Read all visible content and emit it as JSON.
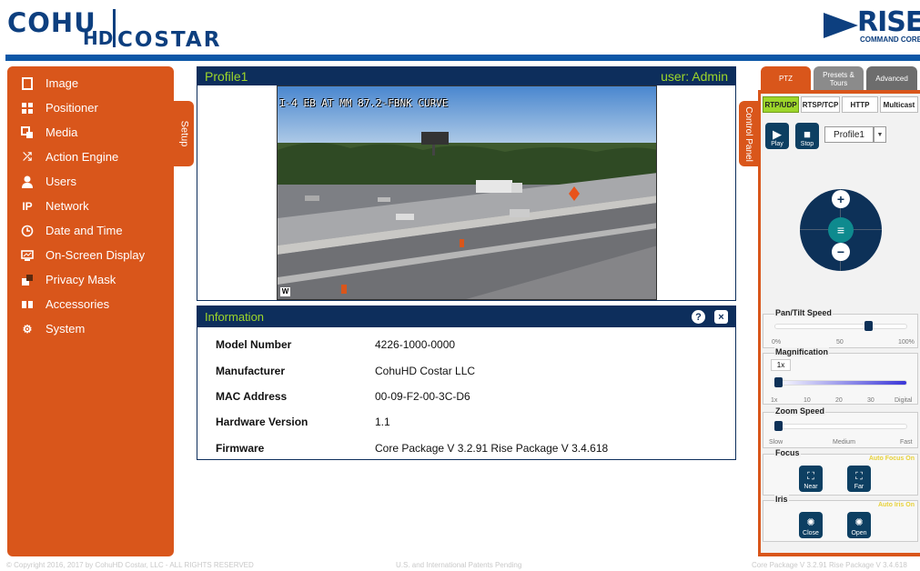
{
  "brand": {
    "left_top": "COHU",
    "left_hd": "HD",
    "left_bottom": "COSTAR",
    "right_word": "RISE",
    "right_sub": "COMMAND CORE"
  },
  "sidebar": {
    "items": [
      {
        "label": "Image",
        "icon": "image-icon"
      },
      {
        "label": "Positioner",
        "icon": "positioner-icon"
      },
      {
        "label": "Media",
        "icon": "media-icon"
      },
      {
        "label": "Action Engine",
        "icon": "shuffle-icon"
      },
      {
        "label": "Users",
        "icon": "user-icon"
      },
      {
        "label": "Network",
        "icon": "ip-icon"
      },
      {
        "label": "Date and Time",
        "icon": "clock-icon"
      },
      {
        "label": "On-Screen Display",
        "icon": "monitor-icon"
      },
      {
        "label": "Privacy Mask",
        "icon": "mask-icon"
      },
      {
        "label": "Accessories",
        "icon": "accessories-icon"
      },
      {
        "label": "System",
        "icon": "gear-icon"
      }
    ],
    "setup_tab": "Setup"
  },
  "video": {
    "profile": "Profile1",
    "user": "user: Admin",
    "caption": "I-4 EB AT MM 87.2-FBNK CURVE",
    "watermark": "W"
  },
  "info": {
    "title": "Information",
    "help": "?",
    "close": "×",
    "rows": [
      {
        "key": "Model Number",
        "value": "4226-1000-0000"
      },
      {
        "key": "Manufacturer",
        "value": "CohuHD Costar LLC"
      },
      {
        "key": "MAC Address",
        "value": "00-09-F2-00-3C-D6"
      },
      {
        "key": "Hardware Version",
        "value": "1.1"
      },
      {
        "key": "Firmware",
        "value": "Core Package V 3.2.91 Rise Package V 3.4.618"
      }
    ]
  },
  "control_panel": {
    "side_tab": "Control Panel",
    "tabs": [
      "PTZ",
      "Presets & Tours",
      "Advanced"
    ],
    "protocols": [
      "RTP/UDP",
      "RTSP/TCP",
      "HTTP",
      "Multicast"
    ],
    "play": "Play",
    "stop": "Stop",
    "profile": "Profile1",
    "pan_tilt": {
      "title": "Pan/Tilt Speed",
      "scale": [
        "0%",
        "50",
        "100%"
      ],
      "value_percent": 72
    },
    "magnification": {
      "title": "Magnification",
      "tooltip": "1x",
      "scale": [
        "1x",
        "10",
        "20",
        "30",
        "Digital"
      ],
      "value_fraction": 0.0
    },
    "zoom_speed": {
      "title": "Zoom Speed",
      "scale": [
        "Slow",
        "Medium",
        "Fast"
      ],
      "value_fraction": 0.0
    },
    "focus": {
      "title": "Focus",
      "auto": "Auto Focus On",
      "near": "Near",
      "far": "Far"
    },
    "iris": {
      "title": "Iris",
      "auto": "Auto Iris On",
      "close": "Close",
      "open": "Open"
    }
  },
  "footer": {
    "copyright": "© Copyright 2016, 2017 by CohuHD Costar, LLC - ALL RIGHTS RESERVED",
    "patents": "U.S. and International Patents Pending",
    "version": "Core Package V 3.2.91 Rise Package V 3.4.618"
  },
  "colors": {
    "navy": "#0d2e5c",
    "orange": "#d9561b",
    "green": "#9dd62a",
    "blue_rule": "#0d57a7"
  }
}
